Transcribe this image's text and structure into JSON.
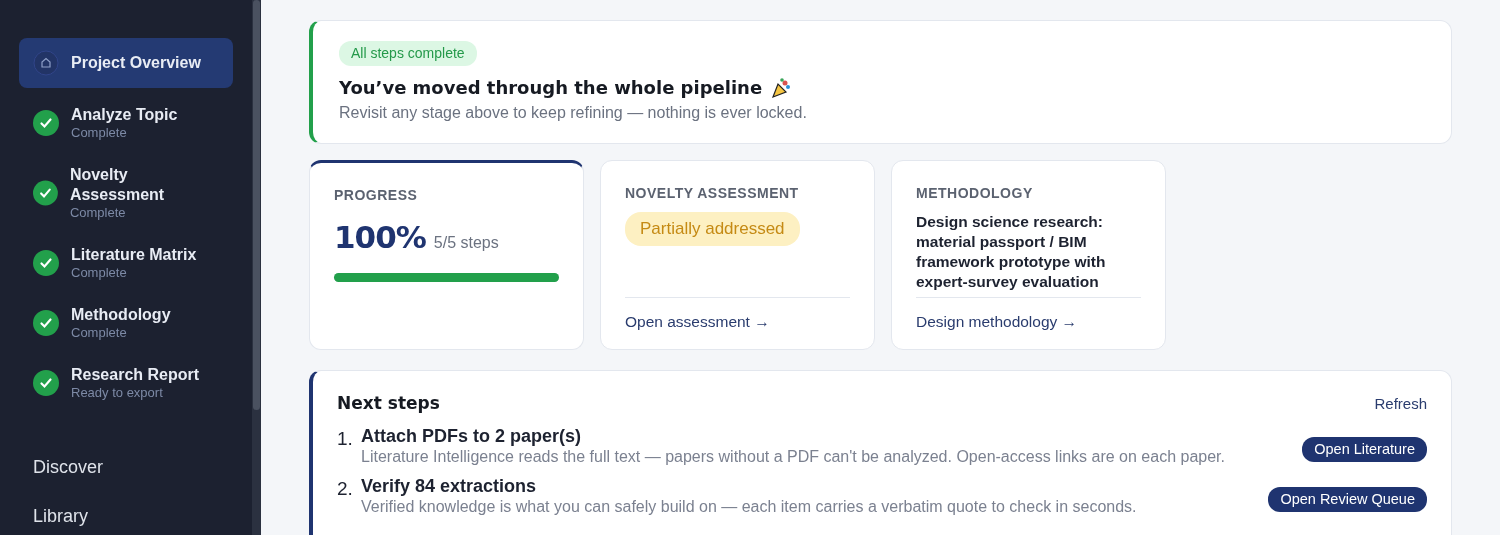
{
  "sidebar": {
    "steps": [
      {
        "kind": "overview",
        "label": "Project Overview",
        "selected": true
      },
      {
        "kind": "step",
        "label": "Analyze Topic",
        "status": "Complete",
        "done": true,
        "selected": false
      },
      {
        "kind": "step",
        "label": "Novelty Assessment",
        "status": "Complete",
        "done": true,
        "selected": false
      },
      {
        "kind": "step",
        "label": "Literature Matrix",
        "status": "Complete",
        "done": true,
        "selected": false
      },
      {
        "kind": "step",
        "label": "Methodology",
        "status": "Complete",
        "done": true,
        "selected": false
      },
      {
        "kind": "step",
        "label": "Research Report",
        "status": "Ready to export",
        "done": true,
        "selected": false
      }
    ],
    "links": [
      {
        "label": "Discover"
      },
      {
        "label": "Library"
      }
    ]
  },
  "banner": {
    "badge": "All steps complete",
    "title": "You’ve moved through the whole pipeline",
    "subtitle": "Revisit any stage above to keep refining — nothing is ever locked."
  },
  "cards": [
    {
      "kind": "progress",
      "heading": "PROGRESS",
      "value": "100%",
      "detail": "5/5 steps",
      "level": 1
    },
    {
      "kind": "status",
      "heading": "NOVELTY ASSESSMENT",
      "status": "Partially addressed",
      "link": "Open assessment →"
    },
    {
      "kind": "text",
      "heading": "METHODOLOGY",
      "body": "Design science research: material passport / BIM framework prototype with expert-survey evaluation",
      "link": "Design methodology →"
    }
  ],
  "next_steps": {
    "title": "Next steps",
    "refresh": "Refresh",
    "items": [
      {
        "number": "1.",
        "title": "Attach PDFs to 2 paper(s)",
        "description": "Literature Intelligence reads the full text — papers without a PDF can't be analyzed. Open-access links are on each paper.",
        "action": "Open Literature"
      },
      {
        "number": "2.",
        "title": "Verify 84 extractions",
        "description": "Verified knowledge is what you can safely build on — each item carries a verbatim quote to check in seconds.",
        "action": "Open Review Queue"
      }
    ]
  }
}
